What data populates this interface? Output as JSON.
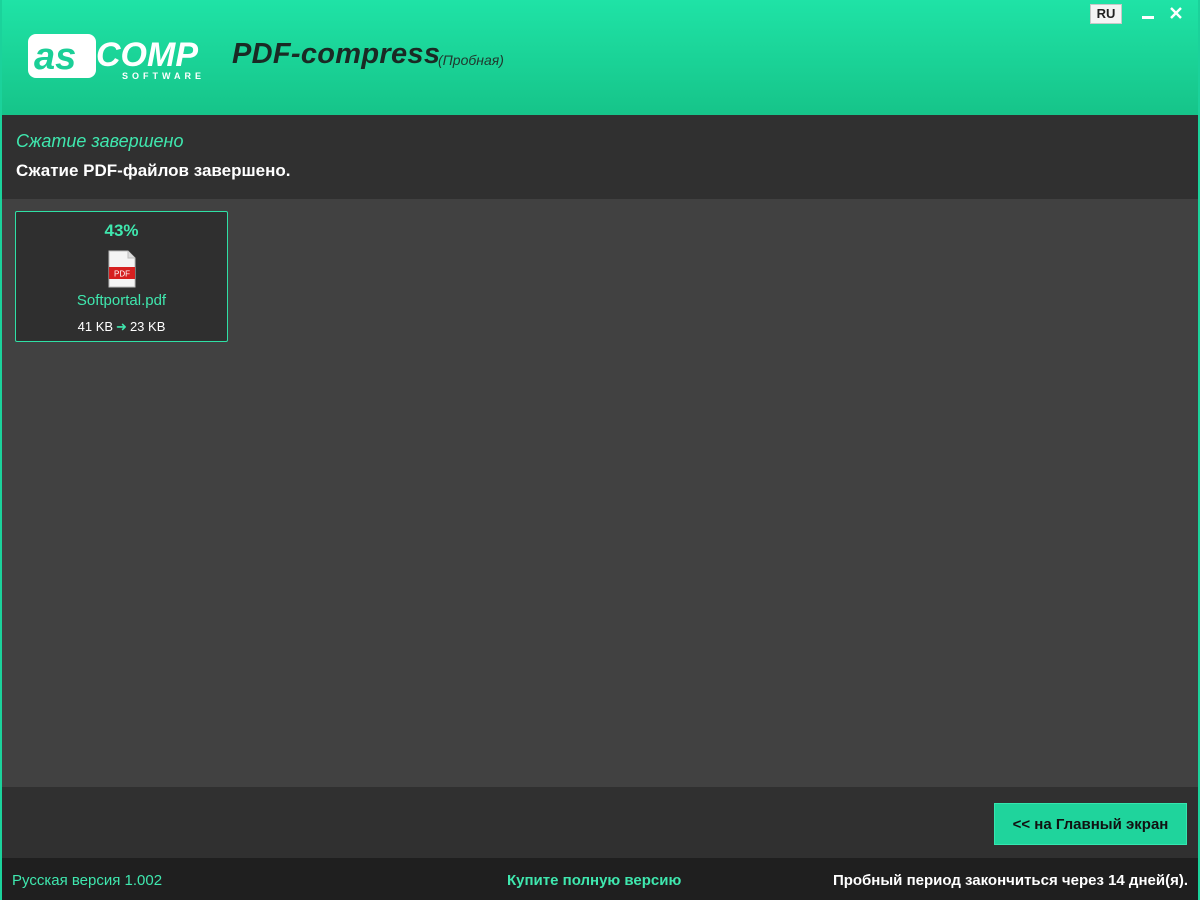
{
  "header": {
    "logo_text": "ASCOMP SOFTWARE",
    "app_title": "PDF-compress",
    "trial_tag": "(Пробная)",
    "language_button": "RU",
    "minimize_icon": "minimize-icon",
    "close_icon": "close-icon"
  },
  "status": {
    "title": "Сжатие завершено",
    "message": "Сжатие PDF-файлов завершено."
  },
  "files": [
    {
      "percent": "43%",
      "icon": "pdf-file-icon",
      "name": "Softportal.pdf",
      "size_before": "41 KB",
      "size_after": "23 KB",
      "arrow": "➜"
    }
  ],
  "actions": {
    "home_button": "<< на Главный экран"
  },
  "statusbar": {
    "version": "Русская версия 1.002",
    "buy_link": "Купите полную версию",
    "trial_notice": "Пробный период закончиться через 14 дней(я)."
  },
  "colors": {
    "accent": "#1fd49c",
    "accent_text": "#3fe7ae",
    "dark_band": "#303030",
    "main_bg": "#414141"
  }
}
